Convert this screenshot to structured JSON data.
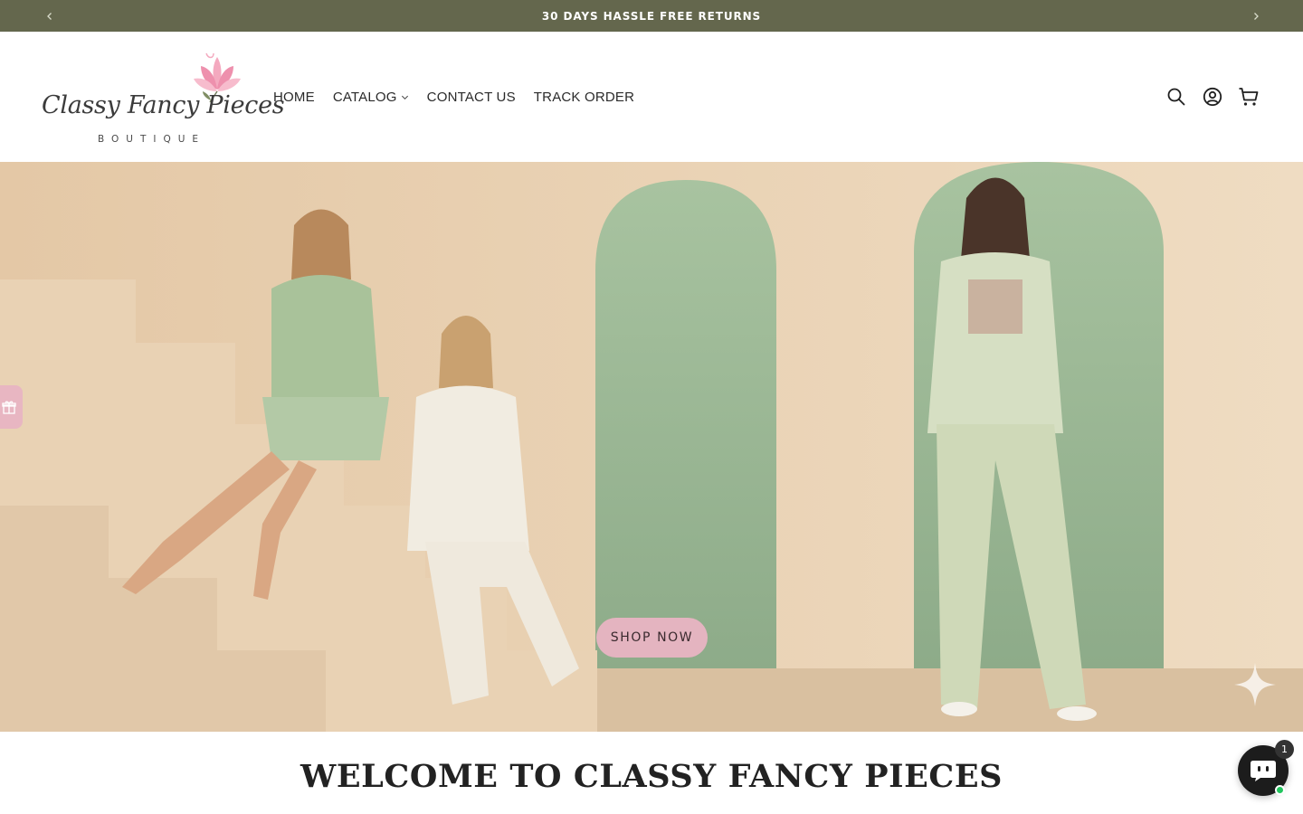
{
  "announcement": {
    "text": "30 DAYS HASSLE FREE RETURNS",
    "prev_icon": "chevron-left-icon",
    "next_icon": "chevron-right-icon"
  },
  "logo": {
    "script_text": "Classy Fancy Pieces",
    "subtitle": "BOUTIQUE",
    "icon": "lotus-flower-icon"
  },
  "nav": {
    "items": [
      {
        "label": "HOME"
      },
      {
        "label": "CATALOG",
        "has_dropdown": true
      },
      {
        "label": "CONTACT US"
      },
      {
        "label": "TRACK ORDER"
      }
    ]
  },
  "header_icons": [
    "search-icon",
    "account-icon",
    "cart-icon"
  ],
  "hero": {
    "button_label": "SHOP NOW",
    "side_tab_icon": "gift-icon",
    "sparkle_icon": "sparkle-icon"
  },
  "welcome": {
    "heading": "WELCOME TO CLASSY FANCY PIECES"
  },
  "chat": {
    "badge_count": "1",
    "icon": "chat-bot-icon"
  },
  "colors": {
    "announcement_bg": "#64674d",
    "accent_pink": "#e4b4c0",
    "hero_sand": "#e6cfb1",
    "hero_sage": "#98b58f"
  }
}
